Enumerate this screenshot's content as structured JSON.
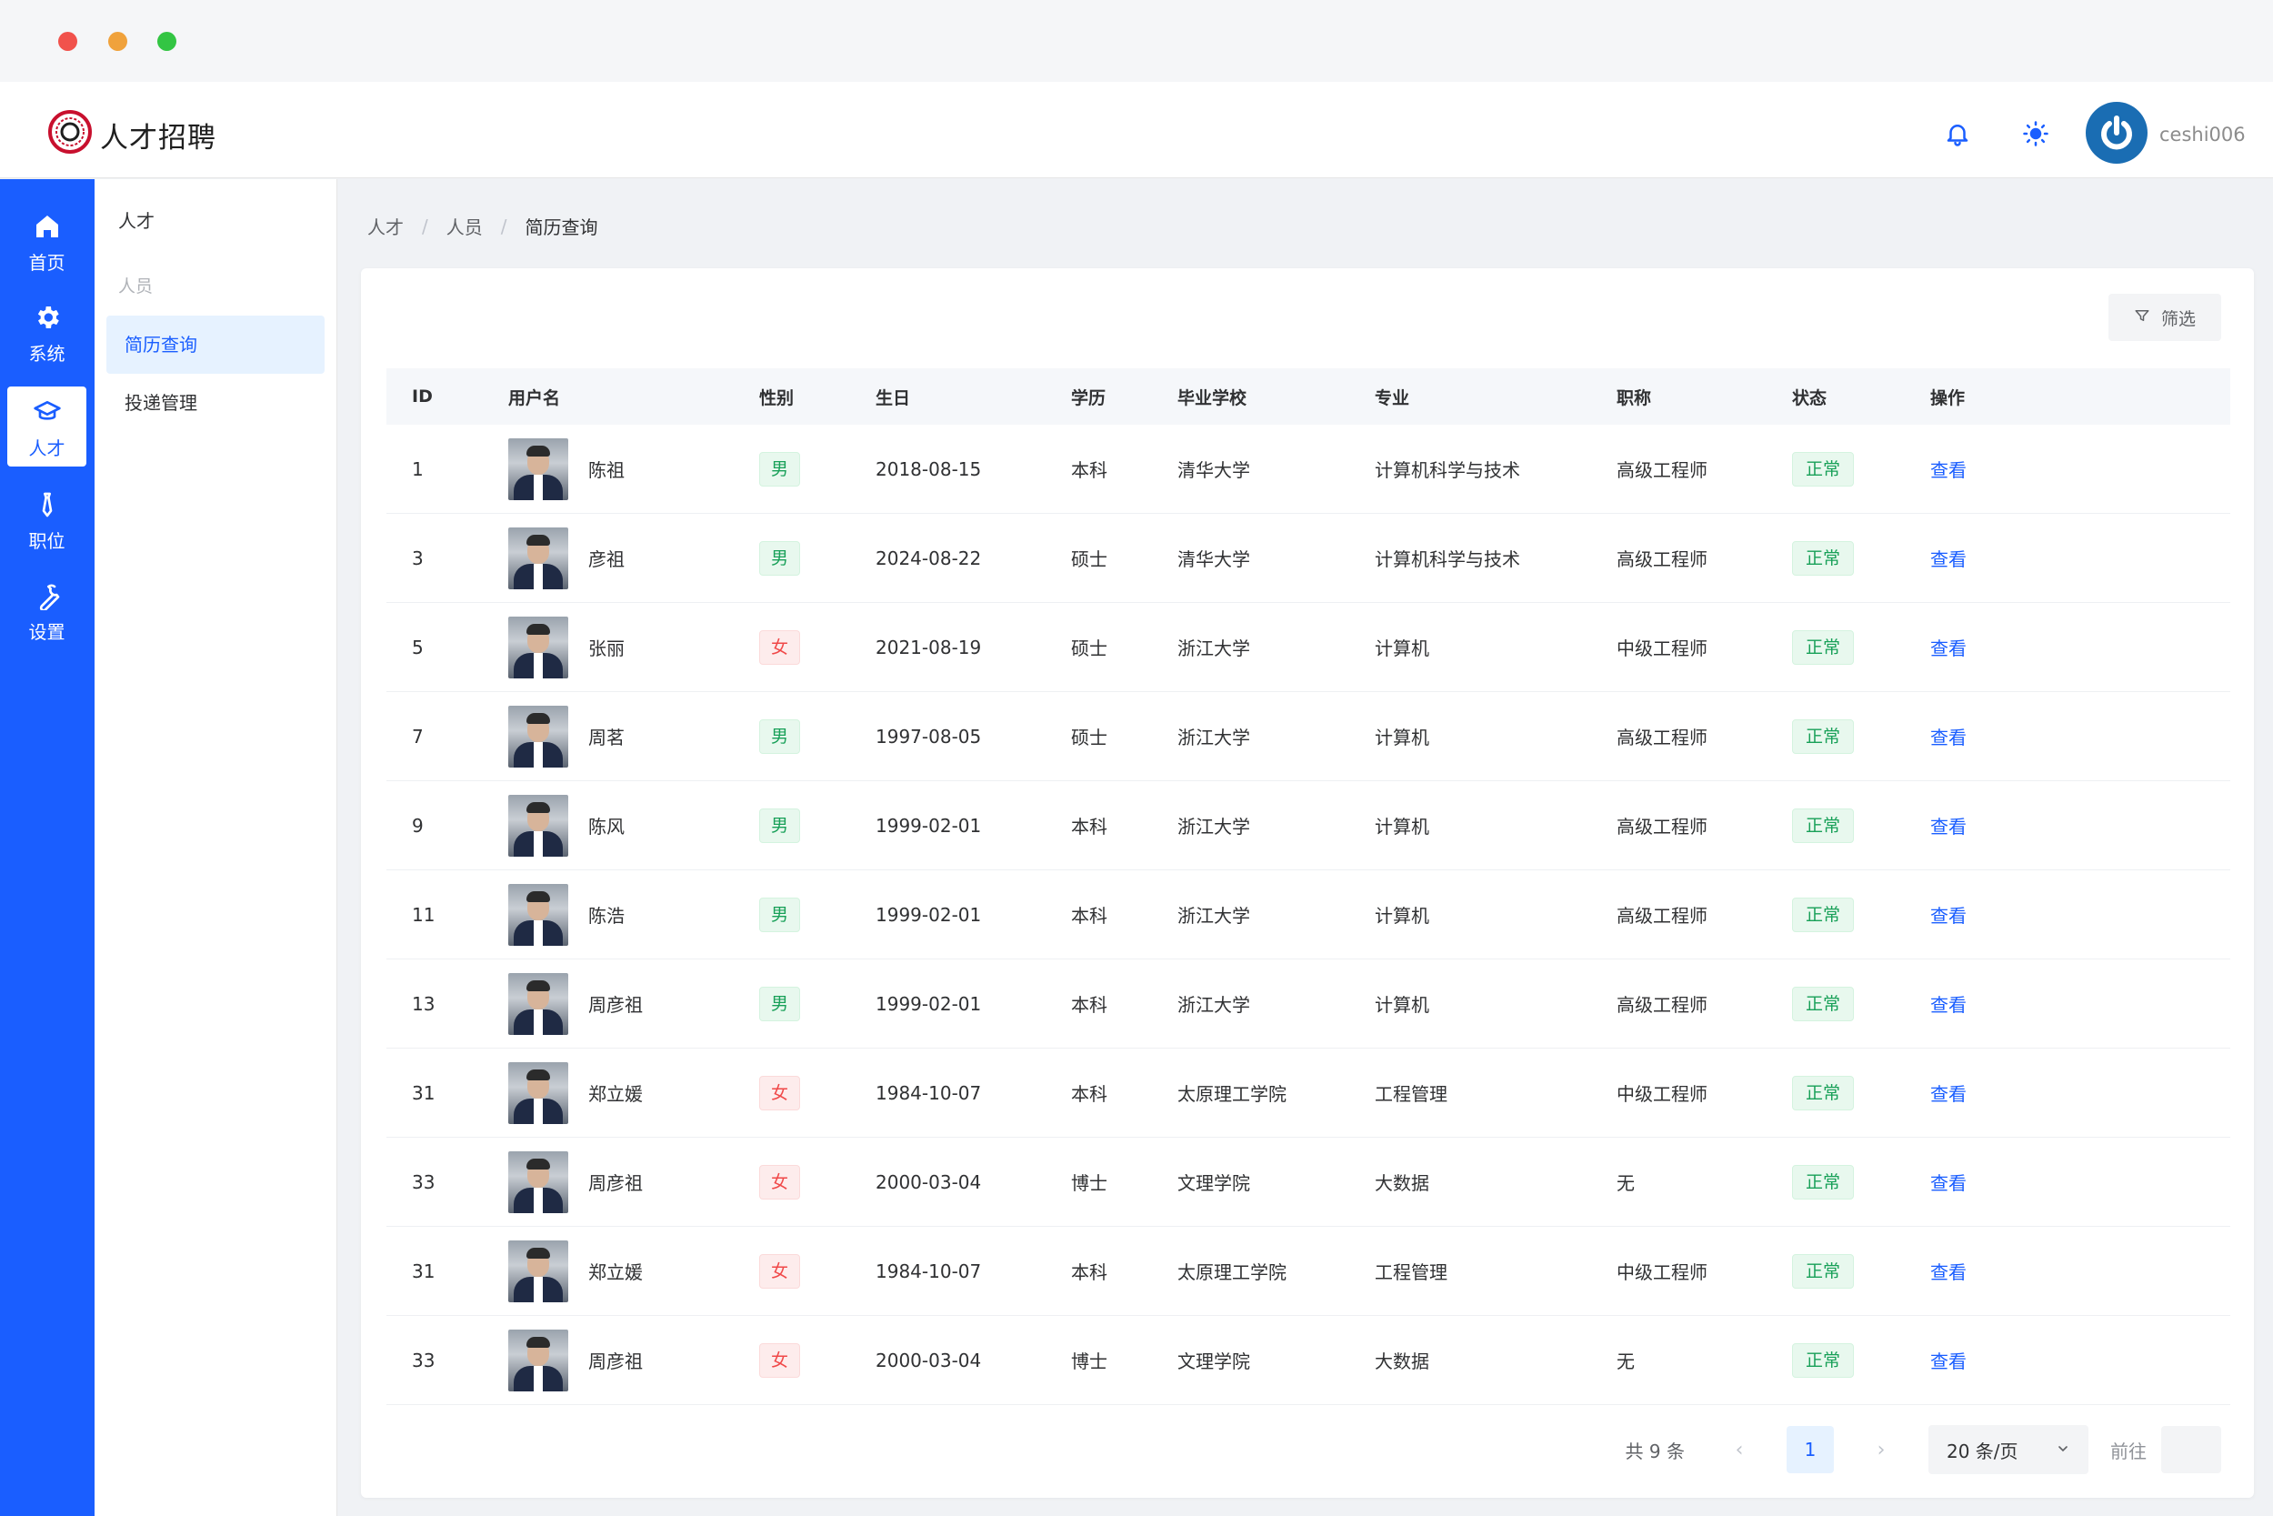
{
  "header": {
    "app_title": "人才招聘",
    "username": "ceshi006"
  },
  "rail": [
    {
      "label": "首页",
      "icon": "home-icon"
    },
    {
      "label": "系统",
      "icon": "gear-icon"
    },
    {
      "label": "人才",
      "icon": "graduation-cap-icon"
    },
    {
      "label": "职位",
      "icon": "tie-icon"
    },
    {
      "label": "设置",
      "icon": "wrench-icon"
    }
  ],
  "submenu": {
    "title": "人才",
    "group": "人员",
    "items": [
      "简历查询",
      "投递管理"
    ]
  },
  "breadcrumb": [
    "人才",
    "人员",
    "简历查询"
  ],
  "toolbar": {
    "filter_label": "筛选"
  },
  "table": {
    "headers": [
      "ID",
      "用户名",
      "性别",
      "生日",
      "学历",
      "毕业学校",
      "专业",
      "职称",
      "状态",
      "操作"
    ],
    "rows": [
      {
        "id": "1",
        "name": "陈祖",
        "sex": "男",
        "birthday": "2018-08-15",
        "edu": "本科",
        "school": "清华大学",
        "major": "计算机科学与技术",
        "title": "高级工程师",
        "status": "正常",
        "op": "查看"
      },
      {
        "id": "3",
        "name": "彦祖",
        "sex": "男",
        "birthday": "2024-08-22",
        "edu": "硕士",
        "school": "清华大学",
        "major": "计算机科学与技术",
        "title": "高级工程师",
        "status": "正常",
        "op": "查看"
      },
      {
        "id": "5",
        "name": "张丽",
        "sex": "女",
        "birthday": "2021-08-19",
        "edu": "硕士",
        "school": "浙江大学",
        "major": "计算机",
        "title": "中级工程师",
        "status": "正常",
        "op": "查看"
      },
      {
        "id": "7",
        "name": "周茗",
        "sex": "男",
        "birthday": "1997-08-05",
        "edu": "硕士",
        "school": "浙江大学",
        "major": "计算机",
        "title": "高级工程师",
        "status": "正常",
        "op": "查看"
      },
      {
        "id": "9",
        "name": "陈风",
        "sex": "男",
        "birthday": "1999-02-01",
        "edu": "本科",
        "school": "浙江大学",
        "major": "计算机",
        "title": "高级工程师",
        "status": "正常",
        "op": "查看"
      },
      {
        "id": "11",
        "name": "陈浩",
        "sex": "男",
        "birthday": "1999-02-01",
        "edu": "本科",
        "school": "浙江大学",
        "major": "计算机",
        "title": "高级工程师",
        "status": "正常",
        "op": "查看"
      },
      {
        "id": "13",
        "name": "周彦祖",
        "sex": "男",
        "birthday": "1999-02-01",
        "edu": "本科",
        "school": "浙江大学",
        "major": "计算机",
        "title": "高级工程师",
        "status": "正常",
        "op": "查看"
      },
      {
        "id": "31",
        "name": "郑立媛",
        "sex": "女",
        "birthday": "1984-10-07",
        "edu": "本科",
        "school": "太原理工学院",
        "major": "工程管理",
        "title": "中级工程师",
        "status": "正常",
        "op": "查看"
      },
      {
        "id": "33",
        "name": "周彦祖",
        "sex": "女",
        "birthday": "2000-03-04",
        "edu": "博士",
        "school": "文理学院",
        "major": "大数据",
        "title": "无",
        "status": "正常",
        "op": "查看"
      },
      {
        "id": "31",
        "name": "郑立媛",
        "sex": "女",
        "birthday": "1984-10-07",
        "edu": "本科",
        "school": "太原理工学院",
        "major": "工程管理",
        "title": "中级工程师",
        "status": "正常",
        "op": "查看"
      },
      {
        "id": "33",
        "name": "周彦祖",
        "sex": "女",
        "birthday": "2000-03-04",
        "edu": "博士",
        "school": "文理学院",
        "major": "大数据",
        "title": "无",
        "status": "正常",
        "op": "查看"
      }
    ]
  },
  "pagination": {
    "total": "共 9 条",
    "current_page": "1",
    "page_size": "20 条/页",
    "goto_label": "前往"
  },
  "colors": {
    "primary": "#1a5eff",
    "success": "#18a058",
    "danger": "#f04848"
  }
}
